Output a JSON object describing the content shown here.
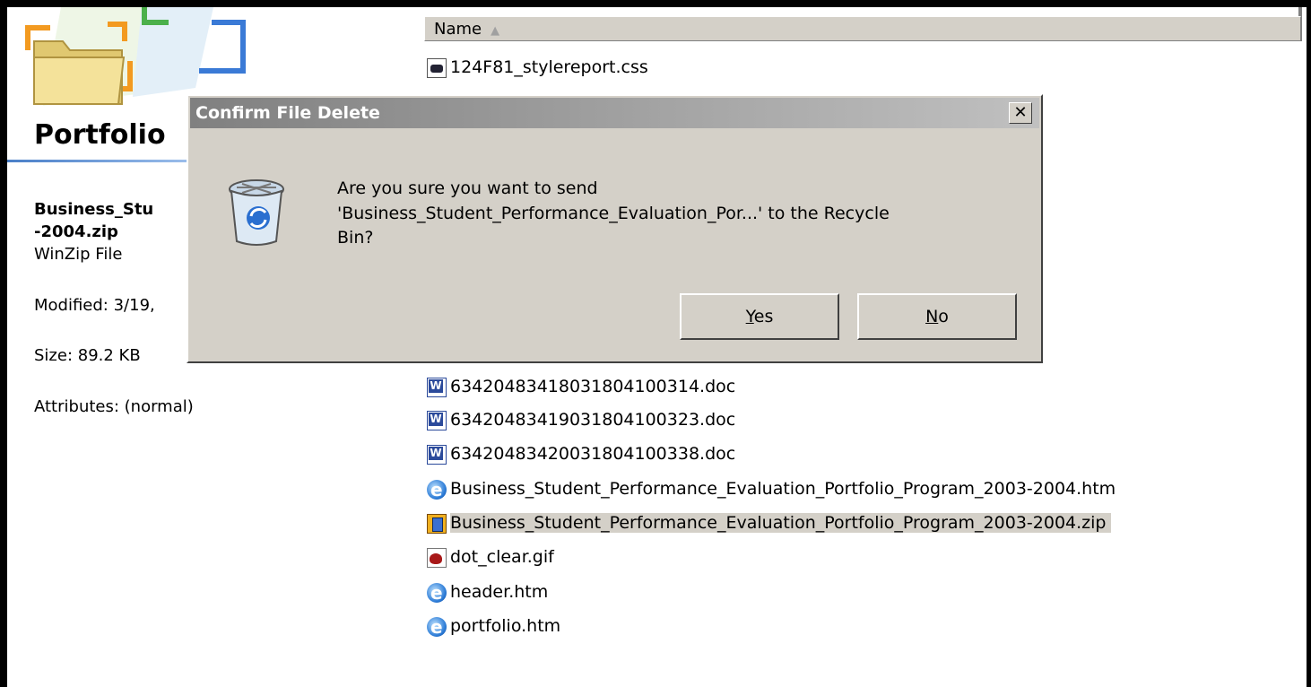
{
  "details_pane": {
    "title": "Portfolio",
    "file_name_line1": "Business_Stu",
    "file_name_line2": "-2004.zip",
    "file_type": "WinZip File",
    "modified": "Modified: 3/19,",
    "size": "Size: 89.2 KB",
    "attributes": "Attributes: (normal)"
  },
  "file_list": {
    "column_header": "Name",
    "sort_indicator": "▲",
    "files": [
      {
        "name": "124F81_stylereport.css",
        "icon": "css-file-icon"
      },
      {
        "name": "634204834180318041003​14.doc",
        "icon": "word-doc-icon"
      },
      {
        "name": "634204834190318041003​23.doc",
        "icon": "word-doc-icon"
      },
      {
        "name": "634204834200318041003​38.doc",
        "icon": "word-doc-icon"
      },
      {
        "name": "Business_Student_Performance_Evaluation_Portfolio_Program_2003-2004.htm",
        "icon": "ie-html-icon"
      },
      {
        "name": "Business_Student_Performance_Evaluation_Portfolio_Program_2003-2004.zip",
        "icon": "winzip-file-icon",
        "selected": true
      },
      {
        "name": "dot_clear.gif",
        "icon": "gif-image-icon"
      },
      {
        "name": "header.htm",
        "icon": "ie-html-icon"
      },
      {
        "name": "portfolio.htm",
        "icon": "ie-html-icon"
      }
    ]
  },
  "dialog": {
    "title": "Confirm File Delete",
    "close_glyph": "✕",
    "message_line1": "Are you sure you want to send",
    "message_line2": "'Business_Student_Performance_Evaluation_Por...' to the Recycle",
    "message_line3": "Bin?",
    "yes_accel": "Y",
    "yes_rest": "es",
    "no_accel": "N",
    "no_rest": "o"
  },
  "colors": {
    "selection": "#d4d0c8",
    "dialog_face": "#d4d0c8",
    "title_gradient_start": "#808080",
    "title_gradient_end": "#c0c0c0"
  }
}
